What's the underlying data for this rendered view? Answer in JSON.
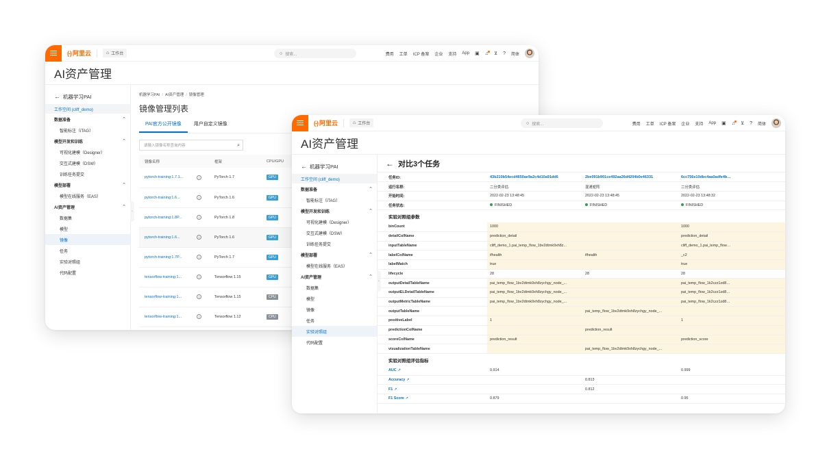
{
  "brand": {
    "logo_glyph": "(-)",
    "logo_text": "阿里云",
    "workbench": "工作台",
    "search_placeholder": "搜索..."
  },
  "toplinks": [
    "费用",
    "工单",
    "ICP 备案",
    "企业",
    "支持",
    "App"
  ],
  "topright_label": "简体",
  "page_title": "AI资产管理",
  "sidebar": {
    "back_label": "机器学习PAI",
    "workspace": "工作空间 (cliff_demo)",
    "groups": [
      {
        "label": "数据准备",
        "items": [
          "智能标注（iTAG）"
        ]
      },
      {
        "label": "模型开发和训练",
        "items": [
          "可视化建模（Designer）",
          "交互式建模（DSW）",
          "训练任务提交"
        ]
      },
      {
        "label": "模型部署",
        "items": [
          "模型在线服务（EAS）"
        ]
      },
      {
        "label": "AI资产管理",
        "items": [
          "数据集",
          "模型",
          "镜像",
          "任务",
          "实验对照组",
          "代码配置"
        ]
      }
    ]
  },
  "w1": {
    "breadcrumb": [
      "机器学习PAI",
      "AI资产管理",
      "镜像管理"
    ],
    "list_title": "镜像管理列表",
    "tabs": [
      "PAI官方公开镜像",
      "用户自定义镜像"
    ],
    "search_placeholder": "请输入镜像名称查询内容",
    "columns": [
      "镜像名称",
      "",
      "框架",
      "CPU/GPU"
    ],
    "rows": [
      {
        "name": "pytorch-training:1.7.1...",
        "framework": "PyTorch 1.7",
        "device": "GPU"
      },
      {
        "name": "pytorch-training:1.6...",
        "framework": "PyTorch 1.6",
        "device": "GPU"
      },
      {
        "name": "pytorch-training:1.8P...",
        "framework": "PyTorch 1.8",
        "device": "GPU"
      },
      {
        "name": "pytorch-training:1.6...",
        "framework": "PyTorch 1.6",
        "device": "GPU"
      },
      {
        "name": "pytorch-training:1.7P...",
        "framework": "PyTorch 1.7",
        "device": "GPU"
      },
      {
        "name": "tensorflow-training:1...",
        "framework": "Tensorflow 1.15",
        "device": "GPU"
      },
      {
        "name": "tensorflow-training:1...",
        "framework": "Tensorflow 1.15",
        "device": "CPU"
      },
      {
        "name": "tensorflow-training:1...",
        "framework": "Tensorflow 1.12",
        "device": "CPU"
      }
    ]
  },
  "w2": {
    "title": "对比3个任务",
    "info_rows": [
      {
        "key": "任务ID:",
        "vals": [
          "43b210b54ecd4650ae9a2c4d10a91dd6",
          "2be091b901ce492aa26d4204b0e46331",
          "6cc756e10dbc4aa0adfe4bb30cfba497"
        ],
        "ids": true
      },
      {
        "key": "运行名称:",
        "vals": [
          "二分类评估",
          "混淆矩阵",
          "二分类评估"
        ]
      },
      {
        "key": "开始时间:",
        "vals": [
          "2022-02-23 13:48:45",
          "2022-02-23 13:48:45",
          "2022-02-23 13:48:32"
        ]
      },
      {
        "key": "任务状态:",
        "vals": [
          "FINISHED",
          "FINISHED",
          "FINISHED"
        ],
        "status": true
      }
    ],
    "param_section": "实验对照组参数",
    "param_rows": [
      {
        "key": "binCount",
        "vals": [
          "1000",
          "",
          "1000"
        ],
        "diff": true
      },
      {
        "key": "detailColName",
        "vals": [
          "prediction_detail",
          "",
          "prediction_detail"
        ],
        "diff": true
      },
      {
        "key": "inputTableName",
        "vals": [
          "cliff_demo_1.pai_temp_flow_1bv2dtmk9xh8z...",
          "",
          "cliff_demo_1.pai_temp_flow_1k2czz1zd80m..."
        ],
        "diff": true
      },
      {
        "key": "labelColName",
        "vals": [
          "ifhealth",
          "ifhealth",
          "_c2"
        ],
        "diff": true
      },
      {
        "key": "labelMatch",
        "vals": [
          "true",
          "",
          "true"
        ],
        "diff": true
      },
      {
        "key": "lifecycle",
        "vals": [
          "28",
          "28",
          "28"
        ],
        "diff": false
      },
      {
        "key": "outputDetailTableName",
        "vals": [
          "pai_temp_flow_1bv2dtmk9xh8zychgy_node_...",
          "",
          "pai_temp_flow_1k2czz1zd80moyvc6c_node_..."
        ],
        "diff": true
      },
      {
        "key": "outputELDetailTableName",
        "vals": [
          "pai_temp_flow_1bv2dtmk9xh8zychgy_node_...",
          "",
          "pai_temp_flow_1k2czz1zd80moyvc6c_node_..."
        ],
        "diff": true
      },
      {
        "key": "outputMetricTableName",
        "vals": [
          "pai_temp_flow_1bv2dtmk9xh8zychgy_node_...",
          "",
          "pai_temp_flow_1k2czz1zd80moyvc6c_node_..."
        ],
        "diff": true
      },
      {
        "key": "outputTableName",
        "vals": [
          "",
          "pai_temp_flow_1bv2dtmk9xh8zychgy_node_...",
          ""
        ],
        "diff": true
      },
      {
        "key": "positiveLabel",
        "vals": [
          "1",
          "",
          "1"
        ],
        "diff": true
      },
      {
        "key": "predictionColName",
        "vals": [
          "",
          "prediction_result",
          ""
        ],
        "diff": true
      },
      {
        "key": "scoreColName",
        "vals": [
          "prediction_result",
          "",
          "prediction_score"
        ],
        "diff": true
      },
      {
        "key": "visualizationTableName",
        "vals": [
          "",
          "pai_temp_flow_1bv2dtmk9xh8zychgy_node_...",
          ""
        ],
        "diff": true
      }
    ],
    "metric_section": "实验对照组评估指标",
    "metric_rows": [
      {
        "key": "AUC",
        "vals": [
          "0.914",
          "",
          "0.999"
        ]
      },
      {
        "key": "Accuracy",
        "vals": [
          "",
          "0.813",
          ""
        ]
      },
      {
        "key": "F1",
        "vals": [
          "",
          "0.812",
          ""
        ]
      },
      {
        "key": "F1 Score",
        "vals": [
          "0.879",
          "",
          "0.95"
        ]
      }
    ]
  },
  "colors": {
    "brand": "#ff6a00",
    "link": "#0070cc",
    "gpu": "#3a9ed8",
    "cpu": "#8a9199",
    "diff_bg": "#fdf5e0",
    "status_ok": "#2ea043"
  }
}
